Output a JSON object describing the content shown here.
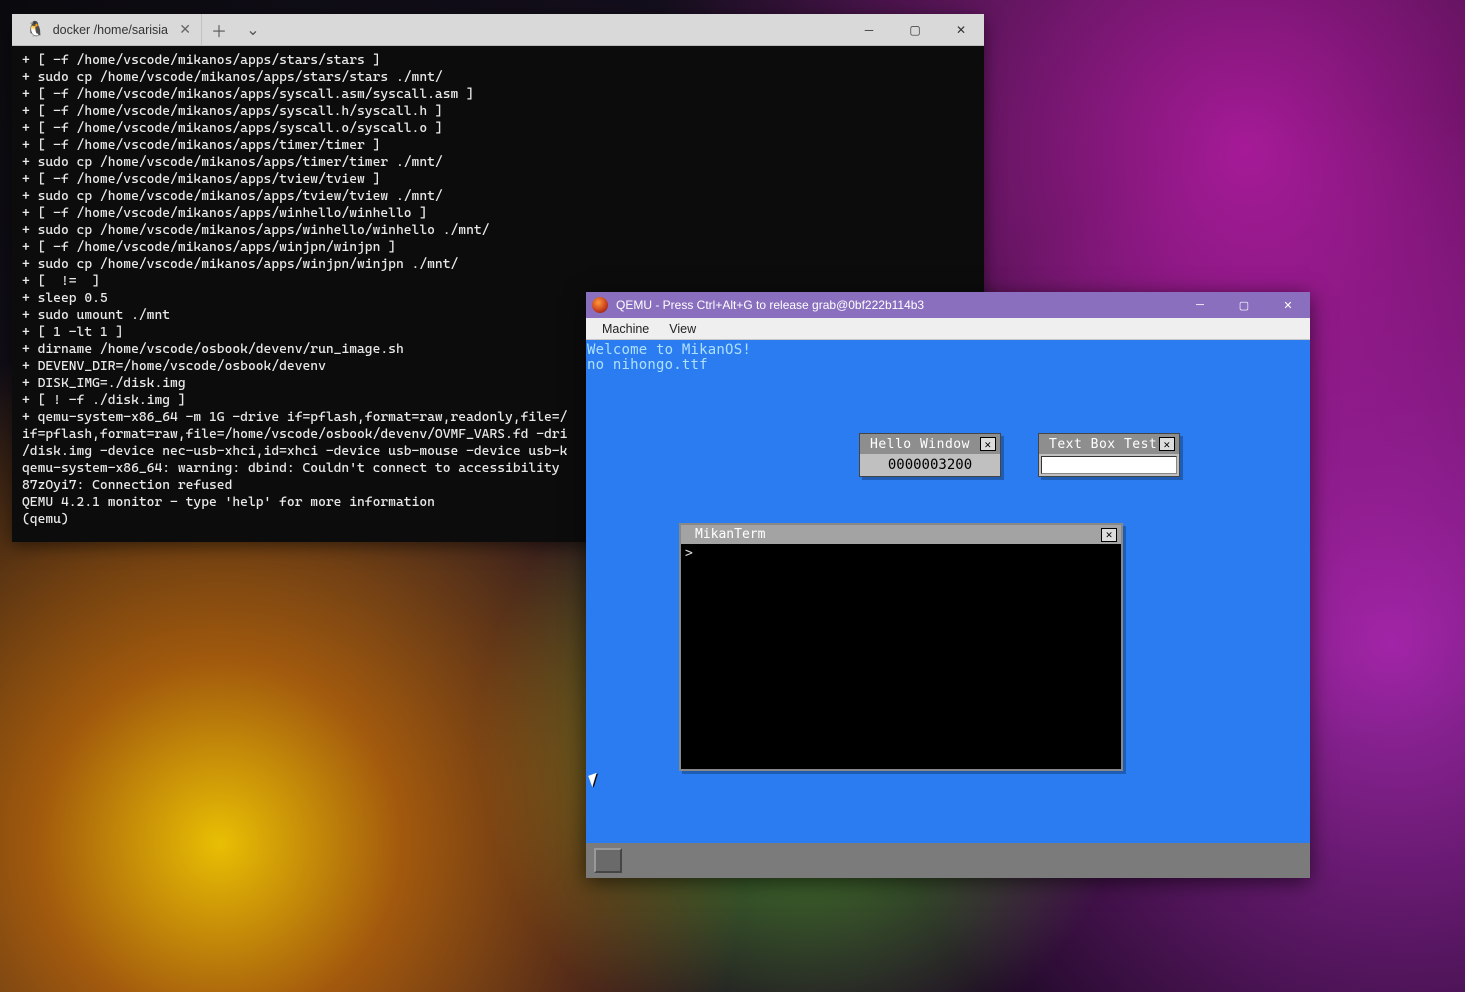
{
  "desktop": {},
  "terminal": {
    "tab_title": "docker /home/sarisia",
    "lines": [
      "+ [ -f /home/vscode/mikanos/apps/stars/stars ]",
      "+ sudo cp /home/vscode/mikanos/apps/stars/stars ./mnt/",
      "+ [ -f /home/vscode/mikanos/apps/syscall.asm/syscall.asm ]",
      "+ [ -f /home/vscode/mikanos/apps/syscall.h/syscall.h ]",
      "+ [ -f /home/vscode/mikanos/apps/syscall.o/syscall.o ]",
      "+ [ -f /home/vscode/mikanos/apps/timer/timer ]",
      "+ sudo cp /home/vscode/mikanos/apps/timer/timer ./mnt/",
      "+ [ -f /home/vscode/mikanos/apps/tview/tview ]",
      "+ sudo cp /home/vscode/mikanos/apps/tview/tview ./mnt/",
      "+ [ -f /home/vscode/mikanos/apps/winhello/winhello ]",
      "+ sudo cp /home/vscode/mikanos/apps/winhello/winhello ./mnt/",
      "+ [ -f /home/vscode/mikanos/apps/winjpn/winjpn ]",
      "+ sudo cp /home/vscode/mikanos/apps/winjpn/winjpn ./mnt/",
      "+ [  !=  ]",
      "+ sleep 0.5",
      "+ sudo umount ./mnt",
      "+ [ 1 -lt 1 ]",
      "+ dirname /home/vscode/osbook/devenv/run_image.sh",
      "+ DEVENV_DIR=/home/vscode/osbook/devenv",
      "+ DISK_IMG=./disk.img",
      "+ [ ! -f ./disk.img ]",
      "+ qemu-system-x86_64 -m 1G -drive if=pflash,format=raw,readonly,file=/",
      "if=pflash,format=raw,file=/home/vscode/osbook/devenv/OVMF_VARS.fd -dri",
      "/disk.img -device nec-usb-xhci,id=xhci -device usb-mouse -device usb-k",
      "qemu-system-x86_64: warning: dbind: Couldn't connect to accessibility ",
      "87zOyi7: Connection refused",
      "QEMU 4.2.1 monitor - type 'help' for more information",
      "(qemu) "
    ]
  },
  "qemu": {
    "title": "QEMU - Press Ctrl+Alt+G to release grab@0bf222b114b3",
    "menus": {
      "machine": "Machine",
      "view": "View"
    },
    "mikanos": {
      "greeting": "Welcome to MikanOS!\nno nihongo.ttf",
      "hello_window": {
        "title": "Hello Window",
        "value": "0000003200"
      },
      "textbox_window": {
        "title": "Text Box Test",
        "value": ""
      },
      "mikanterm": {
        "title": "MikanTerm",
        "prompt": ">"
      }
    }
  }
}
